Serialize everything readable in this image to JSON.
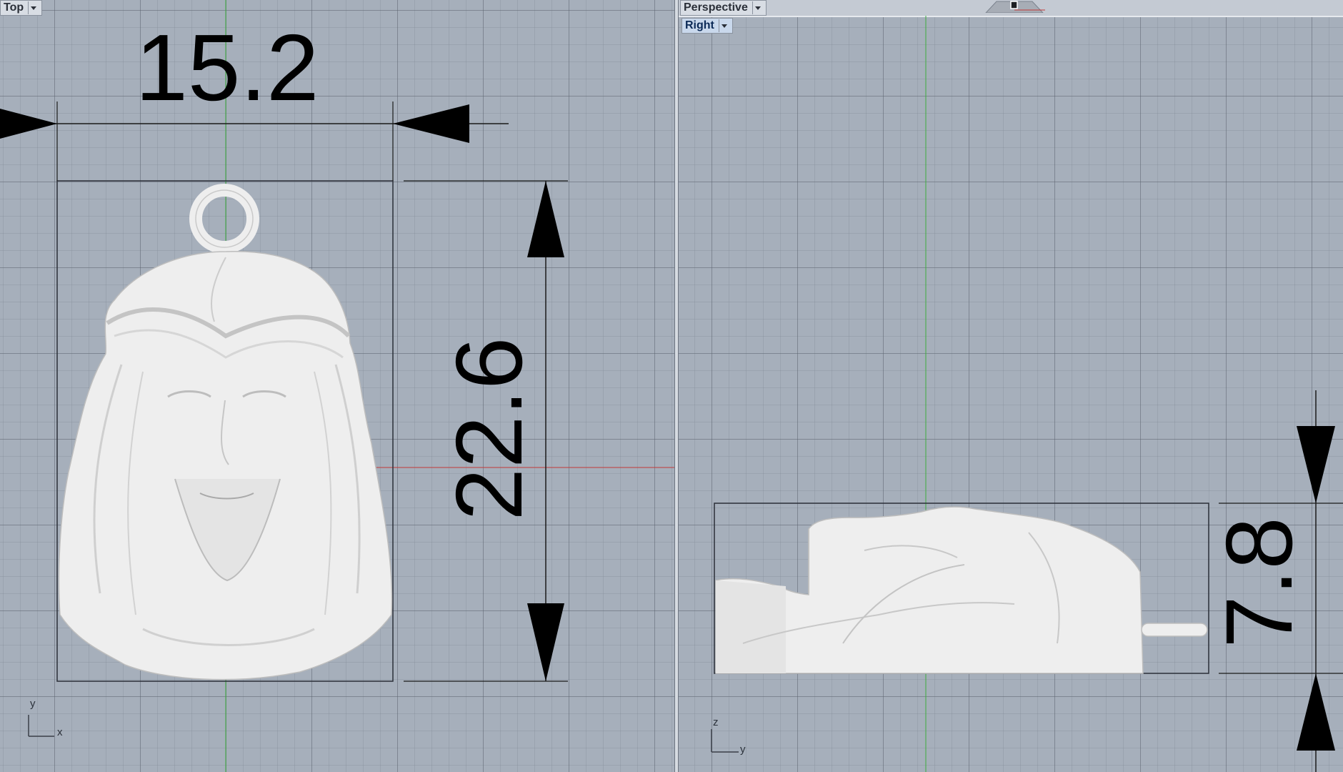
{
  "viewports": {
    "top": {
      "label": "Top",
      "axis_x": "x",
      "axis_y": "y"
    },
    "right": {
      "label": "Right",
      "axis_x": "y",
      "axis_y": "z"
    },
    "perspective": {
      "label": "Perspective"
    }
  },
  "dimensions": {
    "width": "15.2",
    "height": "22.6",
    "depth": "7.8"
  },
  "colors": {
    "viewport_bg": "#a6afbb",
    "grid_line": "#5a626e",
    "axis_green": "#3fae3f",
    "axis_red": "#c23a3a",
    "model": "#eeeeee"
  },
  "icons": [
    "dropdown-caret-icon",
    "perspective-camera-icon"
  ]
}
